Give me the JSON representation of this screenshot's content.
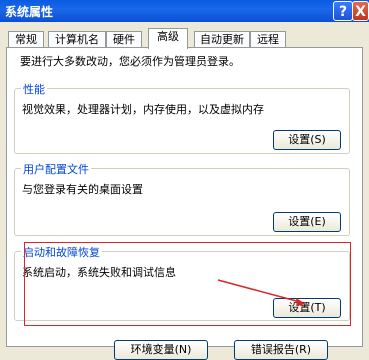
{
  "window": {
    "title": "系统属性",
    "help_label": "?",
    "close_label": "X"
  },
  "tabs": [
    {
      "label": "常规"
    },
    {
      "label": "计算机名"
    },
    {
      "label": "硬件"
    },
    {
      "label": "高级",
      "active": true
    },
    {
      "label": "自动更新"
    },
    {
      "label": "远程"
    }
  ],
  "admin_note": "要进行大多数改动，您必须作为管理员登录。",
  "groups": {
    "performance": {
      "label": "性能",
      "desc": "视觉效果，处理器计划，内存使用，以及虚拟内存",
      "button": "设置(S)"
    },
    "user_profiles": {
      "label": "用户配置文件",
      "desc": "与您登录有关的桌面设置",
      "button": "设置(E)"
    },
    "startup_recovery": {
      "label": "启动和故障恢复",
      "desc": "系统启动，系统失败和调试信息",
      "button": "设置(T)"
    }
  },
  "bottom_buttons": {
    "env": "环境变量(N)",
    "error_report": "错误报告(R)"
  },
  "colors": {
    "title_bar": "#0a5be1",
    "group_label": "#0046d5",
    "highlight": "#d8262b"
  }
}
